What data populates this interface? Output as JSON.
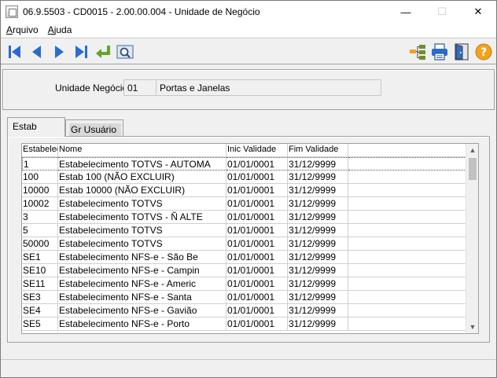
{
  "window": {
    "title": "06.9.5503 - CD0015 - 2.00.00.004 - Unidade de Negócio",
    "minimize": "—",
    "maximize": "☐",
    "close": "✕"
  },
  "menu": {
    "items": [
      "Arquivo",
      "Ajuda"
    ]
  },
  "toolbar": {
    "buttons": [
      {
        "name": "first-record",
        "icon": "first-arrow-icon"
      },
      {
        "name": "previous-record",
        "icon": "prev-arrow-icon"
      },
      {
        "name": "next-record",
        "icon": "next-arrow-icon"
      },
      {
        "name": "last-record",
        "icon": "last-arrow-icon"
      },
      {
        "name": "go-to",
        "icon": "return-arrow-icon"
      },
      {
        "name": "search",
        "icon": "magnifier-icon"
      },
      {
        "name": "tree",
        "icon": "tree-structure-icon"
      },
      {
        "name": "print",
        "icon": "printer-icon"
      },
      {
        "name": "exit",
        "icon": "door-exit-icon"
      },
      {
        "name": "help",
        "icon": "help-question-icon",
        "label": "?"
      }
    ],
    "colors": {
      "nav_blue": "#2a6bd1",
      "go_green": "#62a52a",
      "help_orange": "#f2a21d"
    }
  },
  "unidade": {
    "label": "Unidade Negócio:",
    "code": "01",
    "description": "Portas e Janelas"
  },
  "tabs": [
    {
      "label": "Estab",
      "active": true
    },
    {
      "label": "Gr Usuário",
      "active": false
    }
  ],
  "grid": {
    "columns": [
      "Estabelecimento",
      "Nome",
      "Inic Validade",
      "Fim Validade"
    ],
    "rows": [
      [
        "1",
        "Estabelecimento TOTVS - AUTOMA",
        "01/01/0001",
        "31/12/9999"
      ],
      [
        "100",
        "Estab 100 (NÃO EXCLUIR)",
        "01/01/0001",
        "31/12/9999"
      ],
      [
        "10000",
        "Estab 10000 (NÃO EXCLUIR)",
        "01/01/0001",
        "31/12/9999"
      ],
      [
        "10002",
        "Estabelecimento TOTVS",
        "01/01/0001",
        "31/12/9999"
      ],
      [
        "3",
        "Estabelecimento TOTVS - Ñ ALTE",
        "01/01/0001",
        "31/12/9999"
      ],
      [
        "5",
        "Estabelecimento TOTVS",
        "01/01/0001",
        "31/12/9999"
      ],
      [
        "50000",
        "Estabelecimento TOTVS",
        "01/01/0001",
        "31/12/9999"
      ],
      [
        "SE1",
        "Estabelecimento NFS-e - São Be",
        "01/01/0001",
        "31/12/9999"
      ],
      [
        "SE10",
        "Estabelecimento NFS-e - Campin",
        "01/01/0001",
        "31/12/9999"
      ],
      [
        "SE11",
        "Estabelecimento NFS-e - Americ",
        "01/01/0001",
        "31/12/9999"
      ],
      [
        "SE3",
        "Estabelecimento NFS-e - Santa",
        "01/01/0001",
        "31/12/9999"
      ],
      [
        "SE4",
        "Estabelecimento NFS-e - Gavião",
        "01/01/0001",
        "31/12/9999"
      ],
      [
        "SE5",
        "Estabelecimento NFS-e - Porto",
        "01/01/0001",
        "31/12/9999"
      ]
    ],
    "selected_row": 0
  }
}
